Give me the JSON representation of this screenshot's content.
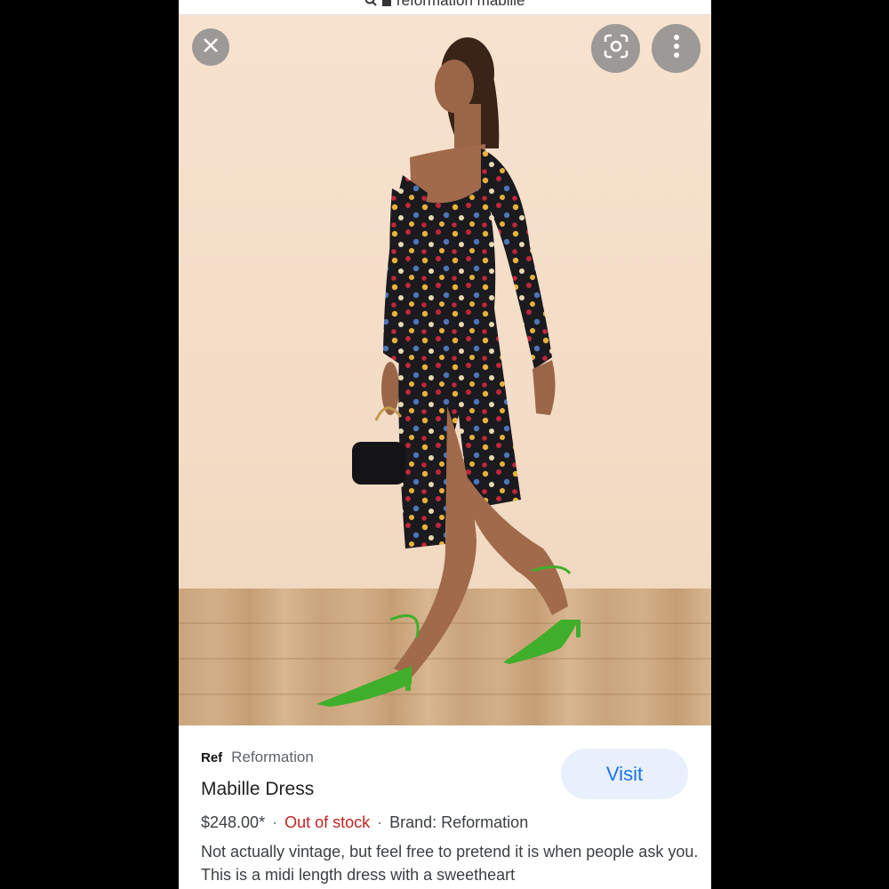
{
  "browser": {
    "url_text": "reformation mabille"
  },
  "image_viewer": {
    "photo_alt": "Woman walking in polka dot midi dress with green heels",
    "close_icon": "close-icon",
    "lens_icon": "google-lens-icon",
    "more_icon": "more-vert-icon"
  },
  "product": {
    "source_logo": "Ref",
    "source_name": "Reformation",
    "title": "Mabille Dress",
    "visit_label": "Visit",
    "price": "$248.00*",
    "stock_status": "Out of stock",
    "brand": "Brand: Reformation",
    "description": "Not actually vintage, but feel free to pretend it is when people ask you. This is a midi length dress with a sweetheart"
  },
  "colors": {
    "visit_bg": "#e8f0fe",
    "visit_text": "#1a73e8",
    "out_of_stock": "#c5221f",
    "shoe_green": "#3fae2a"
  }
}
